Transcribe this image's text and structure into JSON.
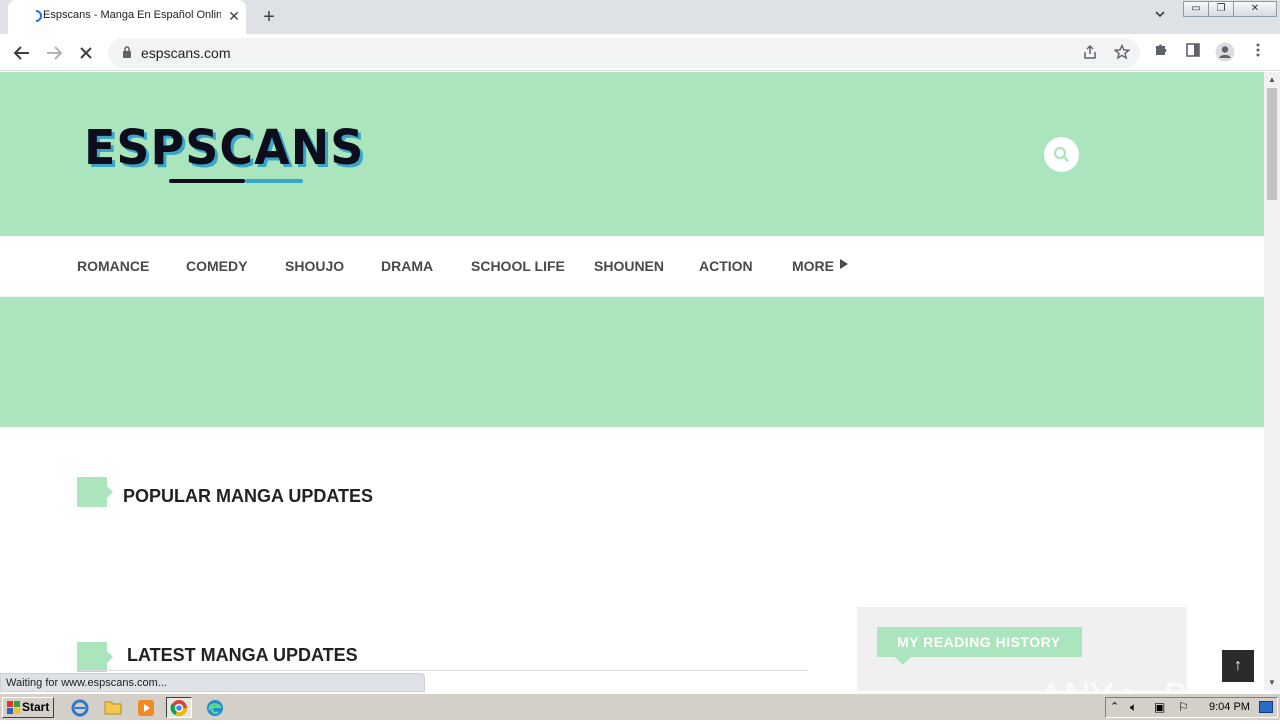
{
  "browser": {
    "tab_title": "Espscans - Manga En Español Online",
    "tab_close": "✕",
    "new_tab": "+",
    "url": "espscans.com",
    "status": "Waiting for www.espscans.com..."
  },
  "site": {
    "logo_text": "ESPSCANS",
    "nav": [
      "ROMANCE",
      "COMEDY",
      "SHOUJO",
      "DRAMA",
      "SCHOOL LIFE",
      "SHOUNEN",
      "ACTION",
      "MORE"
    ],
    "sections": {
      "popular": "POPULAR MANGA UPDATES",
      "latest": "LATEST MANGA UPDATES",
      "history": "MY READING HISTORY"
    },
    "watermark": "ANY ▷ RUN",
    "back_to_top": "↑"
  },
  "taskbar": {
    "start": "Start",
    "clock": "9:04 PM"
  },
  "colors": {
    "accent_green": "#abe5bd",
    "logo_blue": "#3aa6c7"
  }
}
